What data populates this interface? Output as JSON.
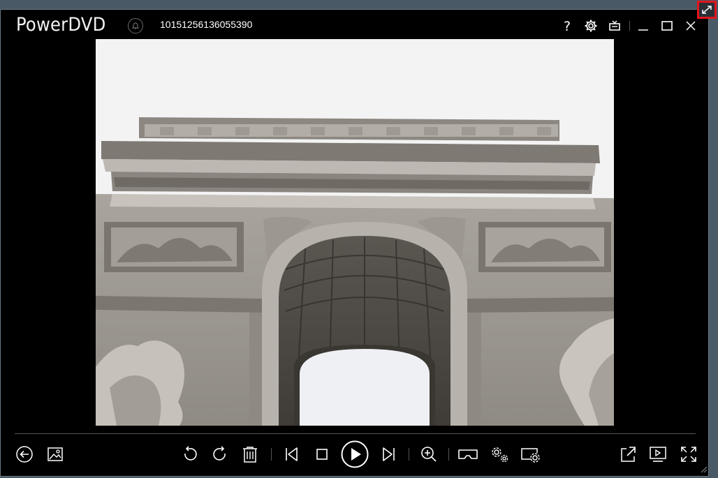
{
  "app": {
    "name": "PowerDVD"
  },
  "file": {
    "title": "10151256136055390"
  },
  "titlebar_buttons": [
    {
      "name": "help-button",
      "icon": "question-icon"
    },
    {
      "name": "settings-button",
      "icon": "gear-icon"
    },
    {
      "name": "tv-mode-button",
      "icon": "tv-icon"
    },
    {
      "name": "minimize-button",
      "icon": "minimize-icon"
    },
    {
      "name": "maximize-button",
      "icon": "maximize-icon"
    },
    {
      "name": "close-button",
      "icon": "close-icon"
    }
  ],
  "image": {
    "subject": "Arc de Triomphe"
  },
  "controls": {
    "left": [
      "back-icon",
      "gallery-icon"
    ],
    "center": [
      "rotate-left-icon",
      "rotate-right-icon",
      "delete-icon",
      "previous-icon",
      "stop-icon",
      "play-icon",
      "next-icon",
      "zoom-in-icon",
      "vr-icon",
      "slideshow-settings-icon",
      "effects-settings-icon"
    ],
    "right": [
      "share-icon",
      "cast-icon",
      "fullscreen-icon"
    ]
  },
  "colors": {
    "background": "#000000",
    "highlight": "#e0161b",
    "desktop": "#4a5966"
  }
}
